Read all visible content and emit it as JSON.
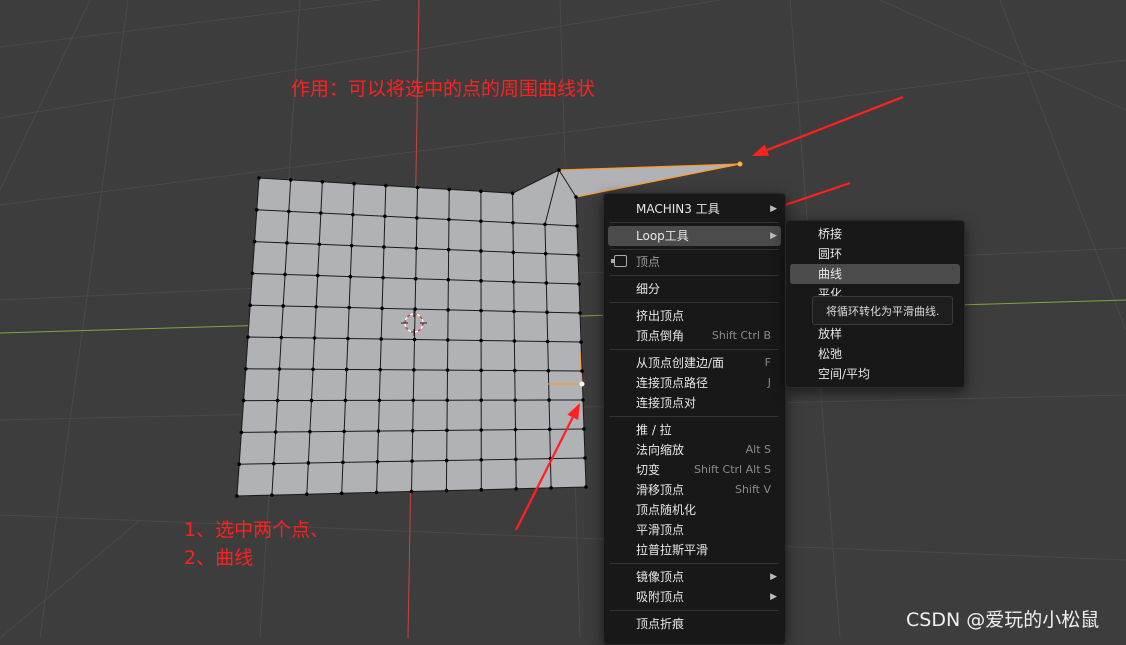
{
  "annotations": {
    "top": "作用：可以将选中的点的周围曲线状",
    "step1": "1、选中两个点、",
    "step2": "2、曲线"
  },
  "watermark": "CSDN @爱玩的小松鼠",
  "colors": {
    "viewport_bg": "#3d3d3d",
    "mesh_face": "#b1b2b5",
    "selection_edge": "#ff9a2a",
    "annotation_red": "#ff2020",
    "x_axis": "#c6453f",
    "y_axis": "#7da83a"
  },
  "context_menu": {
    "items": [
      {
        "label": "MACHIN3 工具",
        "submenu": true
      },
      {
        "label": "Loop工具",
        "submenu": true,
        "active": true
      },
      {
        "label": "顶点",
        "header": true,
        "icon": "vertex-select-icon"
      },
      {
        "label": "细分"
      },
      {
        "label": "挤出顶点"
      },
      {
        "label": "顶点倒角",
        "shortcut": "Shift Ctrl B"
      },
      {
        "label": "从顶点创建边/面",
        "shortcut": "F"
      },
      {
        "label": "连接顶点路径",
        "shortcut": "J"
      },
      {
        "label": "连接顶点对"
      },
      {
        "label": "推 / 拉"
      },
      {
        "label": "法向缩放",
        "shortcut": "Alt S"
      },
      {
        "label": "切变",
        "shortcut": "Shift Ctrl Alt S"
      },
      {
        "label": "滑移顶点",
        "shortcut": "Shift V"
      },
      {
        "label": "顶点随机化"
      },
      {
        "label": "平滑顶点"
      },
      {
        "label": "拉普拉斯平滑"
      },
      {
        "label": "镜像顶点",
        "submenu": true
      },
      {
        "label": "吸附顶点",
        "submenu": true
      },
      {
        "label": "顶点折痕"
      }
    ]
  },
  "loop_submenu": {
    "items": [
      {
        "label": "桥接"
      },
      {
        "label": "圆环"
      },
      {
        "label": "曲线",
        "active": true
      },
      {
        "label": "平化"
      },
      {
        "label": "放样"
      },
      {
        "label": "松弛"
      },
      {
        "label": "空间/平均"
      }
    ]
  },
  "tooltip": "将循环转化为平滑曲线."
}
